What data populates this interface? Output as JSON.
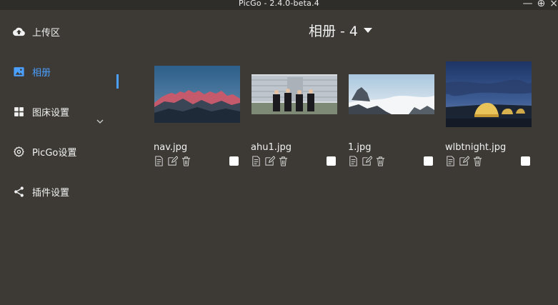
{
  "window": {
    "title": "PicGo - 2.4.0-beta.4",
    "controls": [
      "—",
      "⊕",
      "×"
    ]
  },
  "sidebar": {
    "items": [
      {
        "label": "上传区",
        "icon": "cloud-upload-icon"
      },
      {
        "label": "相册",
        "icon": "image-icon",
        "active": true
      },
      {
        "label": "图床设置",
        "icon": "grid-icon"
      },
      {
        "label": "PicGo设置",
        "icon": "gear-icon"
      },
      {
        "label": "插件设置",
        "icon": "share-icon"
      }
    ]
  },
  "album": {
    "title": "相册 - 4",
    "images": [
      {
        "name": "nav.jpg"
      },
      {
        "name": "ahu1.jpg"
      },
      {
        "name": "1.jpg"
      },
      {
        "name": "wlbtnight.jpg"
      }
    ]
  },
  "colors": {
    "accent": "#4a9fff",
    "background": "#3d3a36"
  }
}
